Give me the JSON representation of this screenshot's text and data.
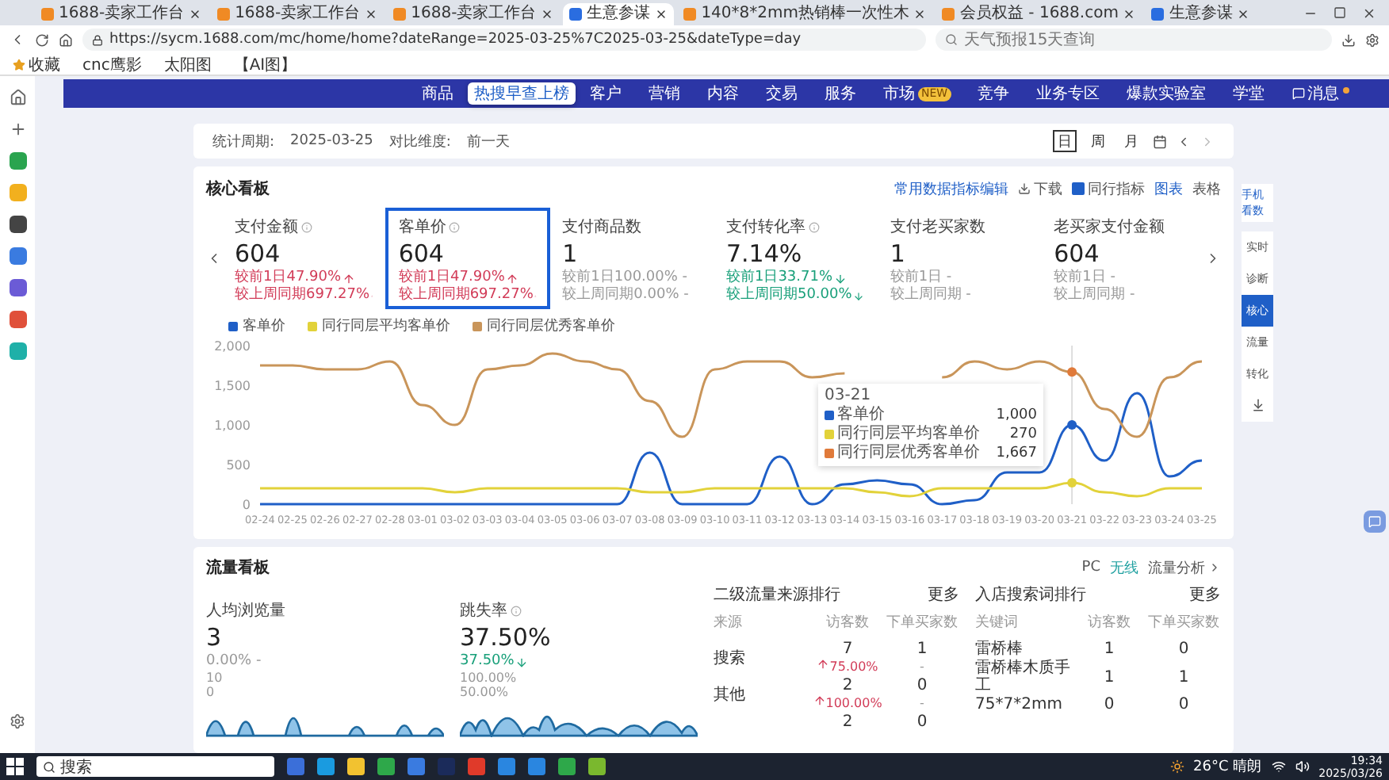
{
  "browser": {
    "tabs": [
      {
        "title": "1688-卖家工作台",
        "kind": "store",
        "selected": false
      },
      {
        "title": "1688-卖家工作台",
        "kind": "store",
        "selected": false
      },
      {
        "title": "1688-卖家工作台",
        "kind": "store",
        "selected": false
      },
      {
        "title": "生意参谋",
        "kind": "report",
        "selected": true
      },
      {
        "title": "140*8*2mm热销棒一次性木",
        "kind": "store",
        "selected": false
      },
      {
        "title": "会员权益 - 1688.com",
        "kind": "store",
        "selected": false
      },
      {
        "title": "生意参谋",
        "kind": "report",
        "selected": false
      }
    ],
    "url": "https://sycm.1688.com/mc/home/home?dateRange=2025-03-25%7C2025-03-25&dateType=day",
    "search_placeholder": "天气预报15天查询",
    "bookmarks": [
      "收藏",
      "cnc鹰影",
      "太阳图",
      "【AI图】"
    ]
  },
  "nav": {
    "items": [
      {
        "label": "商品"
      },
      {
        "label": "客户"
      },
      {
        "label": "营销"
      },
      {
        "label": "内容"
      },
      {
        "label": "交易"
      },
      {
        "label": "服务"
      },
      {
        "label": "市场",
        "badge": "NEW"
      },
      {
        "label": "竞争"
      },
      {
        "label": "业务专区"
      },
      {
        "label": "爆款实验室"
      },
      {
        "label": "学堂"
      }
    ],
    "message": {
      "label": "消息",
      "unread": true
    },
    "popup": "热搜早查上榜"
  },
  "date_bar": {
    "period_label": "统计周期:",
    "period": "2025-03-25",
    "compare_label": "对比维度:",
    "compare": "前一天",
    "ranges": [
      {
        "label": "日",
        "selected": true
      },
      {
        "label": "周",
        "selected": false
      },
      {
        "label": "月",
        "selected": false
      }
    ]
  },
  "core": {
    "title": "核心看板",
    "edit_link": "常用数据指标编辑",
    "download": "下载",
    "peer": {
      "label": "同行指标",
      "checked": true
    },
    "views": [
      {
        "label": "图表",
        "selected": true
      },
      {
        "label": "表格",
        "selected": false
      }
    ],
    "metrics": [
      {
        "label": "支付金额",
        "info": true,
        "value": "604",
        "selected": false,
        "trends": [
          {
            "text": "较前1日47.90%",
            "kind": "up"
          },
          {
            "text": "较上周同期697.27%",
            "kind": "up"
          }
        ]
      },
      {
        "label": "客单价",
        "info": true,
        "value": "604",
        "selected": true,
        "trends": [
          {
            "text": "较前1日47.90%",
            "kind": "up"
          },
          {
            "text": "较上周同期697.27%",
            "kind": "up"
          }
        ]
      },
      {
        "label": "支付商品数",
        "info": false,
        "value": "1",
        "selected": false,
        "trends": [
          {
            "text": "较前1日100.00% -",
            "kind": "flat"
          },
          {
            "text": "较上周同期0.00% -",
            "kind": "flat"
          }
        ]
      },
      {
        "label": "支付转化率",
        "info": true,
        "value": "7.14%",
        "selected": false,
        "trends": [
          {
            "text": "较前1日33.71%",
            "kind": "down"
          },
          {
            "text": "较上周同期50.00%",
            "kind": "down"
          }
        ]
      },
      {
        "label": "支付老买家数",
        "info": false,
        "value": "1",
        "selected": false,
        "trends": [
          {
            "text": "较前1日 -",
            "kind": "flat"
          },
          {
            "text": "较上周同期 -",
            "kind": "flat"
          }
        ]
      },
      {
        "label": "老买家支付金额",
        "info": false,
        "value": "604",
        "selected": false,
        "trends": [
          {
            "text": "较前1日 -",
            "kind": "flat"
          },
          {
            "text": "较上周同期 -",
            "kind": "flat"
          }
        ]
      }
    ],
    "chart_data": {
      "type": "line",
      "x": [
        "02-24",
        "02-25",
        "02-26",
        "02-27",
        "02-28",
        "03-01",
        "03-02",
        "03-03",
        "03-04",
        "03-05",
        "03-06",
        "03-07",
        "03-08",
        "03-09",
        "03-10",
        "03-11",
        "03-12",
        "03-13",
        "03-14",
        "03-15",
        "03-16",
        "03-17",
        "03-18",
        "03-19",
        "03-20",
        "03-21",
        "03-22",
        "03-23",
        "03-24",
        "03-25"
      ],
      "yticks": [
        {
          "value": 0,
          "label": "0"
        },
        {
          "value": 500,
          "label": "500"
        },
        {
          "value": 1000,
          "label": "1,000"
        },
        {
          "value": 1500,
          "label": "1,500"
        },
        {
          "value": 2000,
          "label": "2,000"
        }
      ],
      "ylim": [
        0,
        2000
      ],
      "series": [
        {
          "name": "客单价",
          "color": "#1f5fc7",
          "values": [
            0,
            0,
            0,
            0,
            0,
            0,
            0,
            0,
            0,
            0,
            0,
            0,
            650,
            0,
            0,
            0,
            600,
            0,
            250,
            300,
            250,
            0,
            50,
            400,
            400,
            1000,
            550,
            1400,
            350,
            550
          ]
        },
        {
          "name": "同行同层平均客单价",
          "color": "#e2d23a",
          "values": [
            200,
            200,
            200,
            200,
            200,
            200,
            150,
            200,
            200,
            200,
            200,
            200,
            150,
            150,
            200,
            200,
            200,
            200,
            200,
            150,
            100,
            200,
            200,
            200,
            200,
            270,
            150,
            100,
            200,
            200
          ]
        },
        {
          "name": "同行同层优秀客单价",
          "color": "#c9955a",
          "values": [
            1750,
            1750,
            1700,
            1700,
            1800,
            1250,
            1000,
            1700,
            1750,
            1900,
            1800,
            1700,
            1300,
            850,
            1700,
            1800,
            1800,
            1600,
            1650,
            null,
            null,
            1600,
            1800,
            1700,
            1800,
            1667,
            1200,
            850,
            1600,
            1800
          ]
        }
      ]
    },
    "tooltip": {
      "title": "03-21",
      "rows": [
        {
          "name": "客单价",
          "value": "1,000",
          "color": "#1f5fc7"
        },
        {
          "name": "同行同层平均客单价",
          "value": "270",
          "color": "#e2d23a"
        },
        {
          "name": "同行同层优秀客单价",
          "value": "1,667",
          "color": "#e07a3a"
        }
      ]
    }
  },
  "traffic": {
    "title": "流量看板",
    "platforms": [
      {
        "label": "PC",
        "selected": false
      },
      {
        "label": "无线",
        "selected": true
      }
    ],
    "analysis_link": "流量分析",
    "metrics": [
      {
        "label": "人均浏览量",
        "info": false,
        "value": "3",
        "trend": {
          "text": "0.00% -",
          "kind": "flat"
        },
        "axis": [
          "10",
          "0"
        ]
      },
      {
        "label": "跳失率",
        "info": true,
        "value": "37.50%",
        "trend": {
          "text": "37.50%",
          "kind": "down"
        },
        "axis": [
          "100.00%",
          "50.00%"
        ]
      }
    ],
    "tables": [
      {
        "title": "二级流量来源排行",
        "more": "更多",
        "columns": [
          "来源",
          "访客数",
          "下单买家数"
        ],
        "rows": [
          {
            "name": "搜索",
            "visitors": "7",
            "change": {
              "text": "75.00%",
              "kind": "up"
            },
            "buyers": "1",
            "buyers_change": "-"
          },
          {
            "name": "其他",
            "visitors": "2",
            "change": {
              "text": "100.00%",
              "kind": "up"
            },
            "buyers": "0",
            "buyers_change": "-"
          },
          {
            "visitors": "2",
            "buyers": "0"
          }
        ]
      },
      {
        "title": "入店搜索词排行",
        "more": "更多",
        "columns": [
          "关键词",
          "访客数",
          "下单买家数"
        ],
        "rows": [
          {
            "name": "雷桥棒",
            "visitors": "1",
            "buyers": "0"
          },
          {
            "name": "雷桥棒木质手工",
            "visitors": "1",
            "buyers": "1"
          },
          {
            "name": "75*7*2mm",
            "visitors": "0",
            "buyers": "0"
          }
        ]
      }
    ]
  },
  "float_nav": {
    "feature": "手机看数",
    "items": [
      {
        "label": "实时",
        "selected": false
      },
      {
        "label": "诊断",
        "selected": false
      },
      {
        "label": "核心",
        "selected": true
      },
      {
        "label": "流量",
        "selected": false
      },
      {
        "label": "转化",
        "selected": false
      }
    ]
  },
  "taskbar": {
    "search": "搜索",
    "weather": "26°C 晴朗",
    "time": "19:34",
    "date": "2025/03/26"
  }
}
